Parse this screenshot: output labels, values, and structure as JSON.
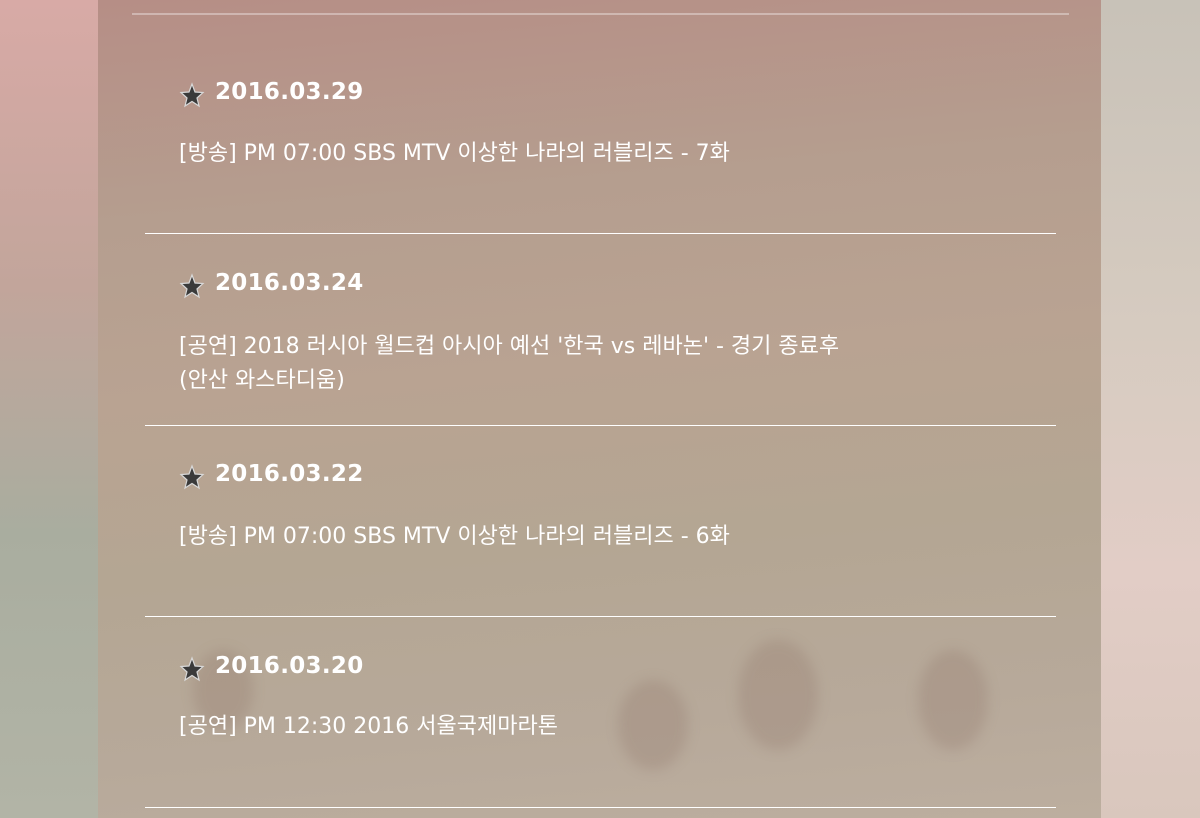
{
  "schedule": {
    "entries": [
      {
        "date": "2016.03.29",
        "text": "[방송] PM 07:00 SBS MTV 이상한 나라의 러블리즈 - 7화"
      },
      {
        "date": "2016.03.24",
        "text": "[공연] 2018 러시아 월드컵 아시아 예선 '한국 vs 레바논' - 경기 종료후\n(안산 와스타디움)"
      },
      {
        "date": "2016.03.22",
        "text": "[방송] PM 07:00 SBS MTV 이상한 나라의 러블리즈 - 6화"
      },
      {
        "date": "2016.03.20",
        "text": "[공연] PM 12:30 2016 서울국제마라톤"
      }
    ]
  },
  "icons": {
    "entry_marker": "star-icon"
  },
  "colors": {
    "text": "#ffffff",
    "divider": "#ffffff"
  }
}
